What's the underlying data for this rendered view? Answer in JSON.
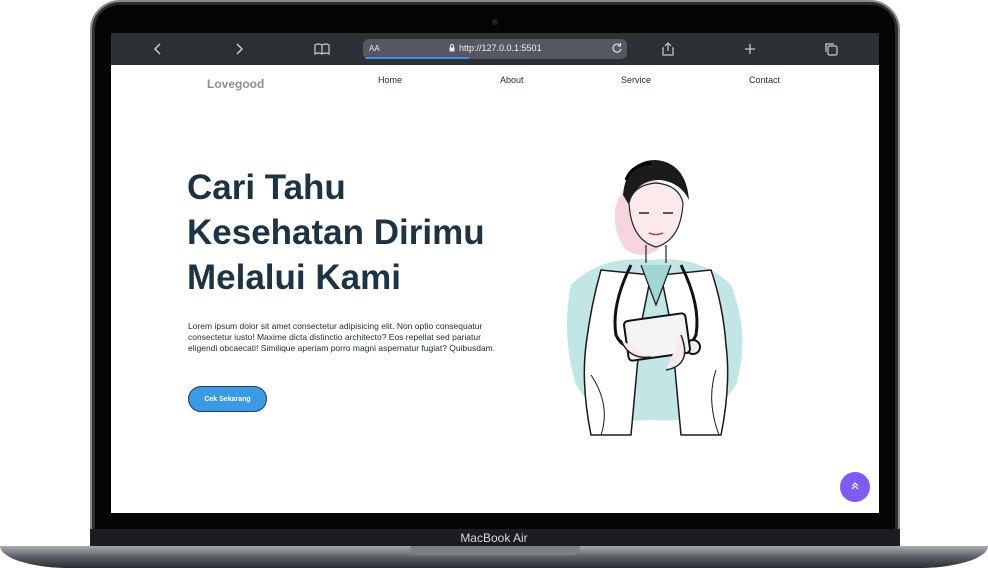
{
  "browser": {
    "url": "http://127.0.0.1:5501",
    "text_size_label": "AA"
  },
  "site": {
    "brand": "Lovegood",
    "nav": [
      "Home",
      "About",
      "Service",
      "Contact"
    ]
  },
  "hero": {
    "title": "Cari Tahu Kesehatan Dirimu Melalui Kami",
    "body": "Lorem ipsum dolor sit amet consectetur adipisicing elit. Non optio consequatur consectetur iusto! Maxime dicta distinctio architecto? Eos repellat sed pariatur eligendi obcaecati! Similique aperiam porro magni aspernatur fugiat? Quibusdam.",
    "cta_label": "Cek Sekarang"
  },
  "device": {
    "model_label": "MacBook Air"
  },
  "colors": {
    "primary": "#3b9ae6",
    "heading": "#1d3344",
    "fab": "#7c5cf3"
  }
}
